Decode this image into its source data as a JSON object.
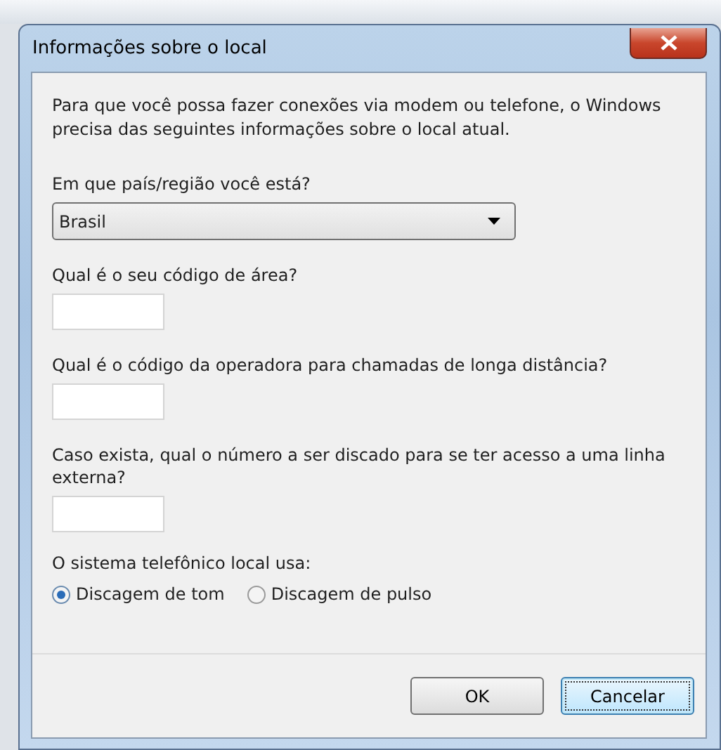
{
  "window": {
    "title": "Informações sobre o local"
  },
  "intro": "Para que você possa fazer conexões via modem ou telefone, o Windows precisa das seguintes informações sobre o local atual.",
  "fields": [
    {
      "kind": "select",
      "label": "Em que país/região você está?",
      "value": "Brasil"
    },
    {
      "kind": "text",
      "label": "Qual é o seu código de área?"
    },
    {
      "kind": "text",
      "label": "Qual é o código da operadora para chamadas de longa distância?"
    },
    {
      "kind": "text",
      "label": "Caso exista, qual o número a ser discado para se ter acesso a uma linha externa?"
    }
  ],
  "dialing": {
    "label": "O sistema telefônico local usa:",
    "options": [
      {
        "label": "Discagem de tom",
        "selected": true
      },
      {
        "label": "Discagem de pulso",
        "selected": false
      }
    ]
  },
  "buttons": [
    {
      "label": "OK",
      "focused": false
    },
    {
      "label": "Cancelar",
      "focused": true
    }
  ]
}
